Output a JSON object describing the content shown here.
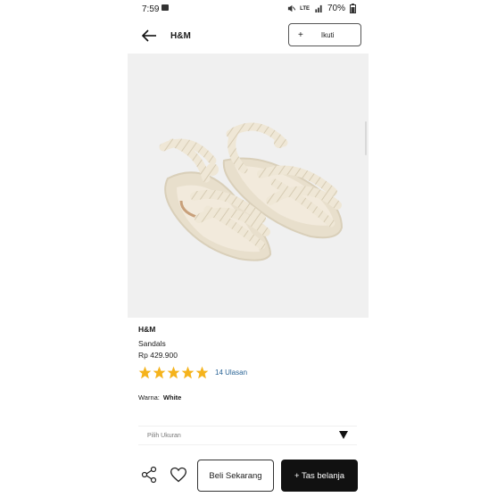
{
  "status_bar": {
    "time": "7:59",
    "network": "LTE",
    "battery": "70%"
  },
  "header": {
    "title": "H&M",
    "follow_plus": "+",
    "follow_label": "Ikuti"
  },
  "product": {
    "brand": "H&M",
    "name": "Sandals",
    "price": "Rp 429.900",
    "rating_stars": 5,
    "reviews": "14 Ulasan",
    "color_label": "Warna:",
    "color_value": "White"
  },
  "size_select": {
    "placeholder": "Pilih Ukuran"
  },
  "actions": {
    "buy_now": "Beli Sekarang",
    "add_to_bag": "+ Tas belanja"
  },
  "colors": {
    "star": "#f5b31c",
    "review_link": "#2a6496",
    "primary_button": "#111111"
  },
  "icons": [
    "image-icon",
    "mute-icon",
    "signal-icon",
    "battery-icon",
    "back-arrow-icon",
    "share-icon",
    "heart-icon",
    "caret-down-icon"
  ]
}
